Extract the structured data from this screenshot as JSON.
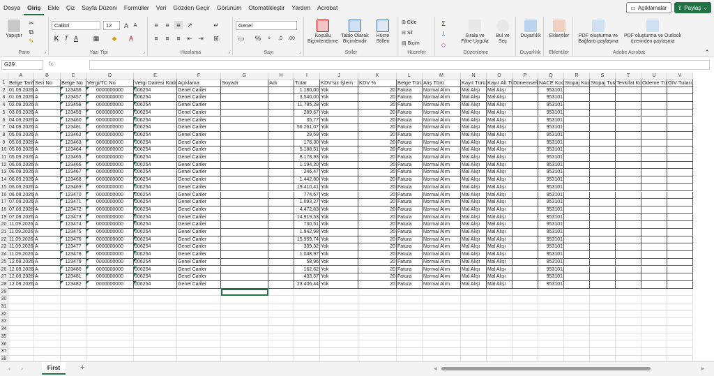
{
  "menu": {
    "items": [
      "Dosya",
      "Giriş",
      "Ekle",
      "Çiz",
      "Sayfa Düzeni",
      "Formüller",
      "Veri",
      "Gözden Geçir",
      "Görünüm",
      "Otomatikleştir",
      "Yardım",
      "Acrobat"
    ],
    "active": "Giriş",
    "comments_label": "Açıklamalar",
    "share_label": "Paylaş"
  },
  "ribbon": {
    "pano": {
      "label": "Pano",
      "paste": "Yapıştır"
    },
    "font": {
      "label": "Yazı Tipi",
      "name": "Calibri",
      "size": "12",
      "bold": "K",
      "italic": "T",
      "underline": "A"
    },
    "align": {
      "label": "Hizalama"
    },
    "number": {
      "label": "Sayı",
      "format": "Genel"
    },
    "styles": {
      "label": "Stiller",
      "conditional": "Koşullu Biçimlendirme",
      "table": "Tablo Olarak Biçimlendir",
      "cell": "Hücre Stilleri"
    },
    "cells": {
      "label": "Hücreler",
      "insert": "Ekle",
      "delete": "Sil",
      "format": "Biçim"
    },
    "editing": {
      "label": "Düzenleme",
      "sort": "Sırala ve Filtre Uygula",
      "find": "Bul ve Seç"
    },
    "sensitivity": {
      "label": "Duyarlılık",
      "button": "Duyarlılık"
    },
    "addins": {
      "label": "Eklentiler",
      "button": "Eklentiler"
    },
    "acrobat": {
      "label": "Adobe Acrobat",
      "pdf_link": "PDF oluşturma ve Bağlantı paylaşma",
      "pdf_outlook": "PDF oluşturma ve Outlook üzerinden paylaşma"
    }
  },
  "formula": {
    "namebox": "G29",
    "fx": "fx",
    "value": ""
  },
  "columns": [
    "A",
    "B",
    "C",
    "D",
    "E",
    "F",
    "G",
    "H",
    "I",
    "J",
    "K",
    "L",
    "M",
    "N",
    "O",
    "P",
    "Q",
    "R",
    "S",
    "T",
    "U",
    "V"
  ],
  "headers": [
    "Belge Tarihi",
    "Seri No",
    "Belge No",
    "Vergi/TC No",
    "Vergi Dairesi Kodu",
    "Açıklama",
    "Soyadı",
    "Adı",
    "Tutar",
    "KDV'siz İşlem",
    "KDV %",
    "Belge Türü",
    "Alış Türü",
    "Kayıt Türü",
    "Kayıt Alt Türü",
    "Dönemsellik",
    "NACE Kodu",
    "Stopaj Kodu",
    "Stopaj Tutarı",
    "Tevkifat Kodu",
    "Ödeme Türü",
    "ÖİV Tutarı"
  ],
  "rows": [
    [
      "01.09.2026",
      "A",
      "123456",
      "0000000000",
      "006254",
      "Genel Cariler",
      "",
      "",
      "1.180,00",
      "Yok",
      "20",
      "Fatura",
      "Normal Alım",
      "Mal Alışı",
      "Mal Alışı",
      "",
      "953101"
    ],
    [
      "01.09.2026",
      "A",
      "123457",
      "0000000000",
      "006254",
      "Genel Cariler",
      "",
      "",
      "3.540,00",
      "Yok",
      "20",
      "Fatura",
      "Normal Alım",
      "Mal Alışı",
      "Mal Alışı",
      "",
      "953101"
    ],
    [
      "02.09.2026",
      "A",
      "123458",
      "0000000000",
      "006254",
      "Genel Cariler",
      "",
      "",
      "11.795,28",
      "Yok",
      "20",
      "Fatura",
      "Normal Alım",
      "Mal Alışı",
      "Mal Alışı",
      "",
      "953101"
    ],
    [
      "03.09.2026",
      "A",
      "123459",
      "0000000000",
      "006254",
      "Genel Cariler",
      "",
      "",
      "289,67",
      "Yok",
      "20",
      "Fatura",
      "Normal Alım",
      "Mal Alışı",
      "Mal Alışı",
      "",
      "953101"
    ],
    [
      "04.09.2026",
      "A",
      "123460",
      "0000000000",
      "006254",
      "Genel Cariler",
      "",
      "",
      "35,77",
      "Yok",
      "20",
      "Fatura",
      "Normal Alım",
      "Mal Alışı",
      "Mal Alışı",
      "",
      "953101"
    ],
    [
      "04.09.2026",
      "A",
      "123461",
      "0000000000",
      "006254",
      "Genel Cariler",
      "",
      "",
      "56.261,07",
      "Yok",
      "20",
      "Fatura",
      "Normal Alım",
      "Mal Alışı",
      "Mal Alışı",
      "",
      "953101"
    ],
    [
      "05.09.2026",
      "A",
      "123462",
      "0000000000",
      "006254",
      "Genel Cariler",
      "",
      "",
      "29,59",
      "Yok",
      "20",
      "Fatura",
      "Normal Alım",
      "Mal Alışı",
      "Mal Alışı",
      "",
      "953101"
    ],
    [
      "05.09.2026",
      "A",
      "123463",
      "0000000000",
      "006254",
      "Genel Cariler",
      "",
      "",
      "176,30",
      "Yok",
      "20",
      "Fatura",
      "Normal Alım",
      "Mal Alışı",
      "Mal Alışı",
      "",
      "953101"
    ],
    [
      "05.09.2026",
      "A",
      "123464",
      "0000000000",
      "006254",
      "Genel Cariler",
      "",
      "",
      "5.188,51",
      "Yok",
      "20",
      "Fatura",
      "Normal Alım",
      "Mal Alışı",
      "Mal Alışı",
      "",
      "953101"
    ],
    [
      "05.09.2026",
      "A",
      "123465",
      "0000000000",
      "006254",
      "Genel Cariler",
      "",
      "",
      "8.178,93",
      "Yok",
      "20",
      "Fatura",
      "Normal Alım",
      "Mal Alışı",
      "Mal Alışı",
      "",
      "953101"
    ],
    [
      "06.09.2026",
      "A",
      "123466",
      "0000000000",
      "006254",
      "Genel Cariler",
      "",
      "",
      "1.194,20",
      "Yok",
      "20",
      "Fatura",
      "Normal Alım",
      "Mal Alışı",
      "Mal Alışı",
      "",
      "953101"
    ],
    [
      "06.09.2026",
      "A",
      "123467",
      "0000000000",
      "006254",
      "Genel Cariler",
      "",
      "",
      "246,47",
      "Yok",
      "20",
      "Fatura",
      "Normal Alım",
      "Mal Alışı",
      "Mal Alışı",
      "",
      "953101"
    ],
    [
      "06.09.2026",
      "A",
      "123468",
      "0000000000",
      "006254",
      "Genel Cariler",
      "",
      "",
      "1.442,80",
      "Yok",
      "20",
      "Fatura",
      "Normal Alım",
      "Mal Alışı",
      "Mal Alışı",
      "",
      "953101"
    ],
    [
      "06.09.2026",
      "A",
      "123469",
      "0000000000",
      "006254",
      "Genel Cariler",
      "",
      "",
      "19.410,41",
      "Yok",
      "20",
      "Fatura",
      "Normal Alım",
      "Mal Alışı",
      "Mal Alışı",
      "",
      "953101"
    ],
    [
      "06.09.2026",
      "A",
      "123470",
      "0000000000",
      "006254",
      "Genel Cariler",
      "",
      "",
      "774,67",
      "Yok",
      "20",
      "Fatura",
      "Normal Alım",
      "Mal Alışı",
      "Mal Alışı",
      "",
      "953101"
    ],
    [
      "07.09.2026",
      "A",
      "123471",
      "0000000000",
      "006254",
      "Genel Cariler",
      "",
      "",
      "1.093,27",
      "Yok",
      "20",
      "Fatura",
      "Normal Alım",
      "Mal Alışı",
      "Mal Alışı",
      "",
      "953101"
    ],
    [
      "07.09.2026",
      "A",
      "123472",
      "0000000000",
      "006254",
      "Genel Cariler",
      "",
      "",
      "4.472,83",
      "Yok",
      "20",
      "Fatura",
      "Normal Alım",
      "Mal Alışı",
      "Mal Alışı",
      "",
      "953101"
    ],
    [
      "07.09.2026",
      "A",
      "123473",
      "0000000000",
      "006254",
      "Genel Cariler",
      "",
      "",
      "14.919,53",
      "Yok",
      "20",
      "Fatura",
      "Normal Alım",
      "Mal Alışı",
      "Mal Alışı",
      "",
      "953101"
    ],
    [
      "11.09.2026",
      "A",
      "123474",
      "0000000000",
      "006254",
      "Genel Cariler",
      "",
      "",
      "730,51",
      "Yok",
      "20",
      "Fatura",
      "Normal Alım",
      "Mal Alışı",
      "Mal Alışı",
      "",
      "953101"
    ],
    [
      "11.09.2026",
      "A",
      "123475",
      "0000000000",
      "006254",
      "Genel Cariler",
      "",
      "",
      "1.942,98",
      "Yok",
      "20",
      "Fatura",
      "Normal Alım",
      "Mal Alışı",
      "Mal Alışı",
      "",
      "953101"
    ],
    [
      "11.09.2026",
      "A",
      "123476",
      "0000000000",
      "006254",
      "Genel Cariler",
      "",
      "",
      "15.959,74",
      "Yok",
      "20",
      "Fatura",
      "Normal Alım",
      "Mal Alışı",
      "Mal Alışı",
      "",
      "953101"
    ],
    [
      "11.09.2026",
      "A",
      "123477",
      "0000000000",
      "006254",
      "Genel Cariler",
      "",
      "",
      "339,32",
      "Yok",
      "20",
      "Fatura",
      "Normal Alım",
      "Mal Alışı",
      "Mal Alışı",
      "",
      "953101"
    ],
    [
      "11.09.2026",
      "A",
      "123478",
      "0000000000",
      "006254",
      "Genel Cariler",
      "",
      "",
      "1.048,97",
      "Yok",
      "20",
      "Fatura",
      "Normal Alım",
      "Mal Alışı",
      "Mal Alışı",
      "",
      "953101"
    ],
    [
      "12.09.2026",
      "A",
      "123479",
      "0000000000",
      "006254",
      "Genel Cariler",
      "",
      "",
      "58,96",
      "Yok",
      "20",
      "Fatura",
      "Normal Alım",
      "Mal Alışı",
      "Mal Alışı",
      "",
      "953101"
    ],
    [
      "12.09.2026",
      "A",
      "123480",
      "0000000000",
      "006254",
      "Genel Cariler",
      "",
      "",
      "162,62",
      "Yok",
      "20",
      "Fatura",
      "Normal Alım",
      "Mal Alışı",
      "Mal Alışı",
      "",
      "953101"
    ],
    [
      "12.09.2026",
      "A",
      "123481",
      "0000000000",
      "006254",
      "Genel Cariler",
      "",
      "",
      "433,57",
      "Yok",
      "20",
      "Fatura",
      "Normal Alım",
      "Mal Alışı",
      "Mal Alışı",
      "",
      "953101"
    ],
    [
      "12.09.2026",
      "A",
      "123482",
      "0000000000",
      "006254",
      "Genel Cariler",
      "",
      "",
      "23.406,44",
      "Yok",
      "20",
      "Fatura",
      "Normal Alım",
      "Mal Alışı",
      "Mal Alışı",
      "",
      "953101"
    ]
  ],
  "row_numbers": [
    "1",
    "2",
    "3",
    "4",
    "5",
    "6",
    "7",
    "8",
    "9",
    "10",
    "11",
    "12",
    "13",
    "14",
    "15",
    "16",
    "17",
    "18",
    "19",
    "20",
    "21",
    "22",
    "23",
    "24",
    "25",
    "26",
    "27",
    "28",
    "29",
    "30",
    "31",
    "32",
    "33",
    "34",
    "35",
    "36",
    "37",
    "38"
  ],
  "sheet": {
    "tab_name": "First",
    "add_label": "+"
  },
  "colors": {
    "accent": "#217346",
    "marker": "#217346"
  }
}
